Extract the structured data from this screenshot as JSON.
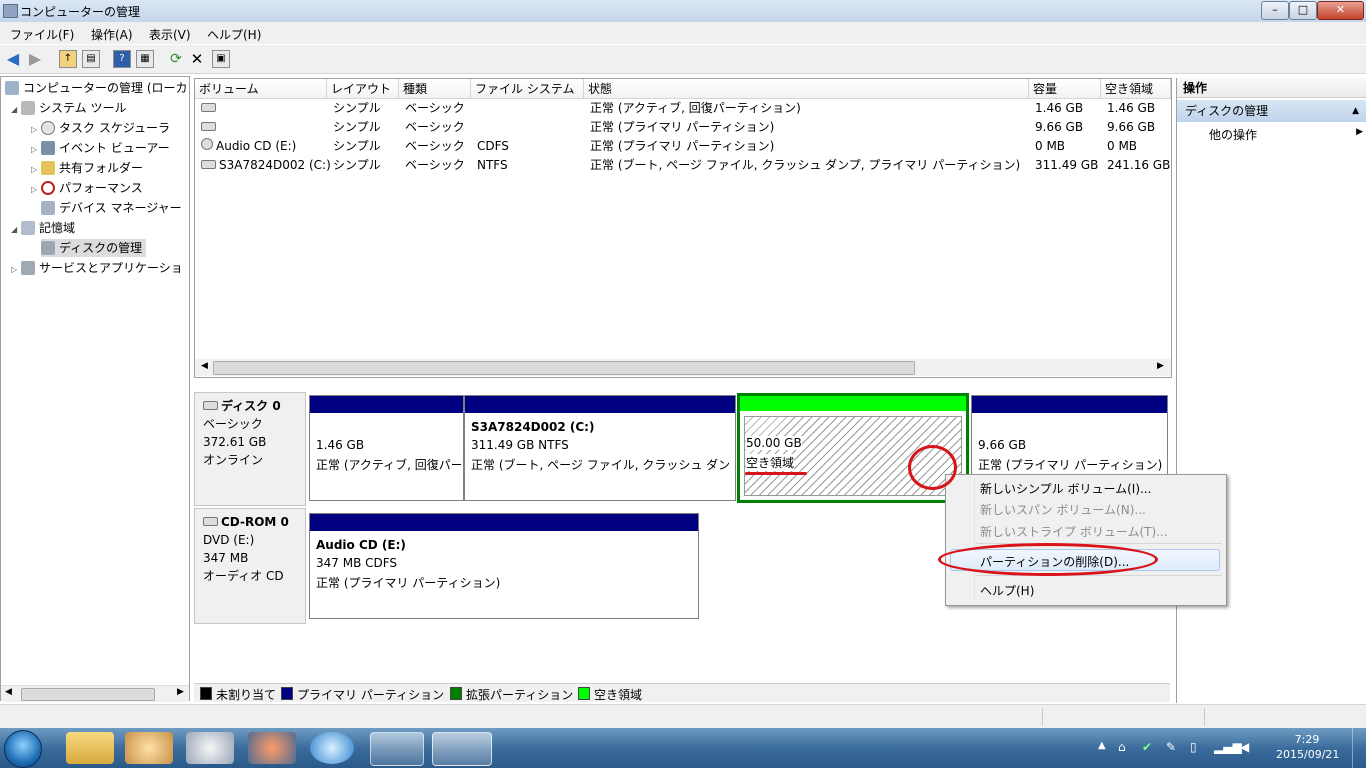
{
  "window": {
    "title": "コンピューターの管理",
    "buttons": {
      "minimize": "–",
      "maximize": "□",
      "close": "✕"
    }
  },
  "menubar": [
    "ファイル(F)",
    "操作(A)",
    "表示(V)",
    "ヘルプ(H)"
  ],
  "tree": {
    "root": "コンピューターの管理 (ローカ",
    "system_tools": "システム ツール",
    "task_scheduler": "タスク スケジューラ",
    "event_viewer": "イベント ビューアー",
    "shared_folders": "共有フォルダー",
    "performance": "パフォーマンス",
    "device_manager": "デバイス マネージャー",
    "storage": "記憶域",
    "disk_management": "ディスクの管理",
    "services_apps": "サービスとアプリケーショ"
  },
  "table": {
    "headers": [
      "ボリューム",
      "レイアウト",
      "種類",
      "ファイル システム",
      "状態",
      "容量",
      "空き領域"
    ],
    "rows": [
      {
        "volume": "",
        "layout": "シンプル",
        "type": "ベーシック",
        "fs": "",
        "status": "正常 (アクティブ, 回復パーティション)",
        "capacity": "1.46 GB",
        "free": "1.46 GB"
      },
      {
        "volume": "",
        "layout": "シンプル",
        "type": "ベーシック",
        "fs": "",
        "status": "正常 (プライマリ パーティション)",
        "capacity": "9.66 GB",
        "free": "9.66 GB"
      },
      {
        "volume": "Audio CD (E:)",
        "layout": "シンプル",
        "type": "ベーシック",
        "fs": "CDFS",
        "status": "正常 (プライマリ パーティション)",
        "capacity": "0 MB",
        "free": "0 MB"
      },
      {
        "volume": "S3A7824D002 (C:)",
        "layout": "シンプル",
        "type": "ベーシック",
        "fs": "NTFS",
        "status": "正常 (ブート, ページ ファイル, クラッシュ ダンプ, プライマリ パーティション)",
        "capacity": "311.49 GB",
        "free": "241.16 GB"
      }
    ]
  },
  "disk0": {
    "name": "ディスク 0",
    "type": "ベーシック",
    "size": "372.61 GB",
    "state": "オンライン",
    "p1": {
      "size": "1.46 GB",
      "status": "正常 (アクティブ, 回復パー"
    },
    "p2": {
      "name": "S3A7824D002  (C:)",
      "size": "311.49 GB NTFS",
      "status": "正常 (ブート, ページ ファイル, クラッシュ ダン"
    },
    "p3": {
      "size": "50.00 GB",
      "status": "空き領域"
    },
    "p4": {
      "size": "9.66 GB",
      "status": "正常 (プライマリ パーティション)"
    }
  },
  "cdrom0": {
    "name": "CD-ROM 0",
    "type": "DVD (E:)",
    "size": "347 MB",
    "state": "オーディオ CD",
    "p1": {
      "name": "Audio CD  (E:)",
      "size": "347 MB CDFS",
      "status": "正常 (プライマリ パーティション)"
    }
  },
  "legend": [
    "未割り当て",
    "プライマリ パーティション",
    "拡張パーティション",
    "空き領域"
  ],
  "actions": {
    "header": "操作",
    "section": "ディスクの管理",
    "other": "他の操作"
  },
  "context_menu": {
    "new_simple": "新しいシンプル ボリューム(I)...",
    "new_spanned": "新しいスパン ボリューム(N)...",
    "new_striped": "新しいストライプ ボリューム(T)...",
    "delete_partition": "パーティションの削除(D)...",
    "help": "ヘルプ(H)"
  },
  "clock": {
    "time": "7:29",
    "date": "2015/09/21"
  },
  "colors": {
    "primary": "#000080",
    "extended": "#008000",
    "free": "#00ff00",
    "unallocated": "#000000",
    "annotation": "#d8141a"
  },
  "icons": [
    "back-arrow-icon",
    "forward-arrow-icon",
    "up-folder-icon",
    "console-tree-icon",
    "help-icon",
    "properties-icon",
    "refresh-icon",
    "delete-icon",
    "export-icon"
  ]
}
